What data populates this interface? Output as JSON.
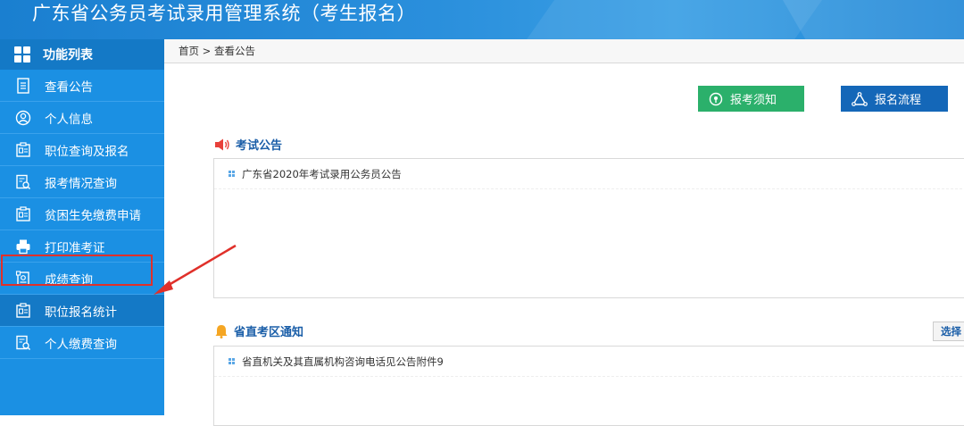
{
  "header": {
    "title": "广东省公务员考试录用管理系统（考生报名）"
  },
  "sidebar": {
    "heading": "功能列表",
    "items": [
      {
        "label": "查看公告",
        "icon": "document-icon"
      },
      {
        "label": "个人信息",
        "icon": "user-icon"
      },
      {
        "label": "职位查询及报名",
        "icon": "id-card-icon"
      },
      {
        "label": "报考情况查询",
        "icon": "search-document-icon"
      },
      {
        "label": "贫困生免缴费申请",
        "icon": "id-card-icon"
      },
      {
        "label": "打印准考证",
        "icon": "printer-icon"
      },
      {
        "label": "成绩查询",
        "icon": "score-document-icon"
      },
      {
        "label": "职位报名统计",
        "icon": "id-card-icon"
      },
      {
        "label": "个人缴费查询",
        "icon": "search-document-icon"
      }
    ]
  },
  "breadcrumb": "首页 > 查看公告",
  "buttons": {
    "notice": "报考须知",
    "process": "报名流程"
  },
  "exam_announcements": {
    "title": "考试公告",
    "items": [
      "广东省2020年考试录用公务员公告"
    ]
  },
  "district_notice": {
    "title": "省直考区通知",
    "select_label": "选择",
    "items": [
      "省直机关及其直属机构咨询电话见公告附件9"
    ]
  },
  "colors": {
    "accent": "#1b90e3",
    "highlight": "#e0302a",
    "green": "#2bb06b",
    "navy": "#1467b8"
  }
}
